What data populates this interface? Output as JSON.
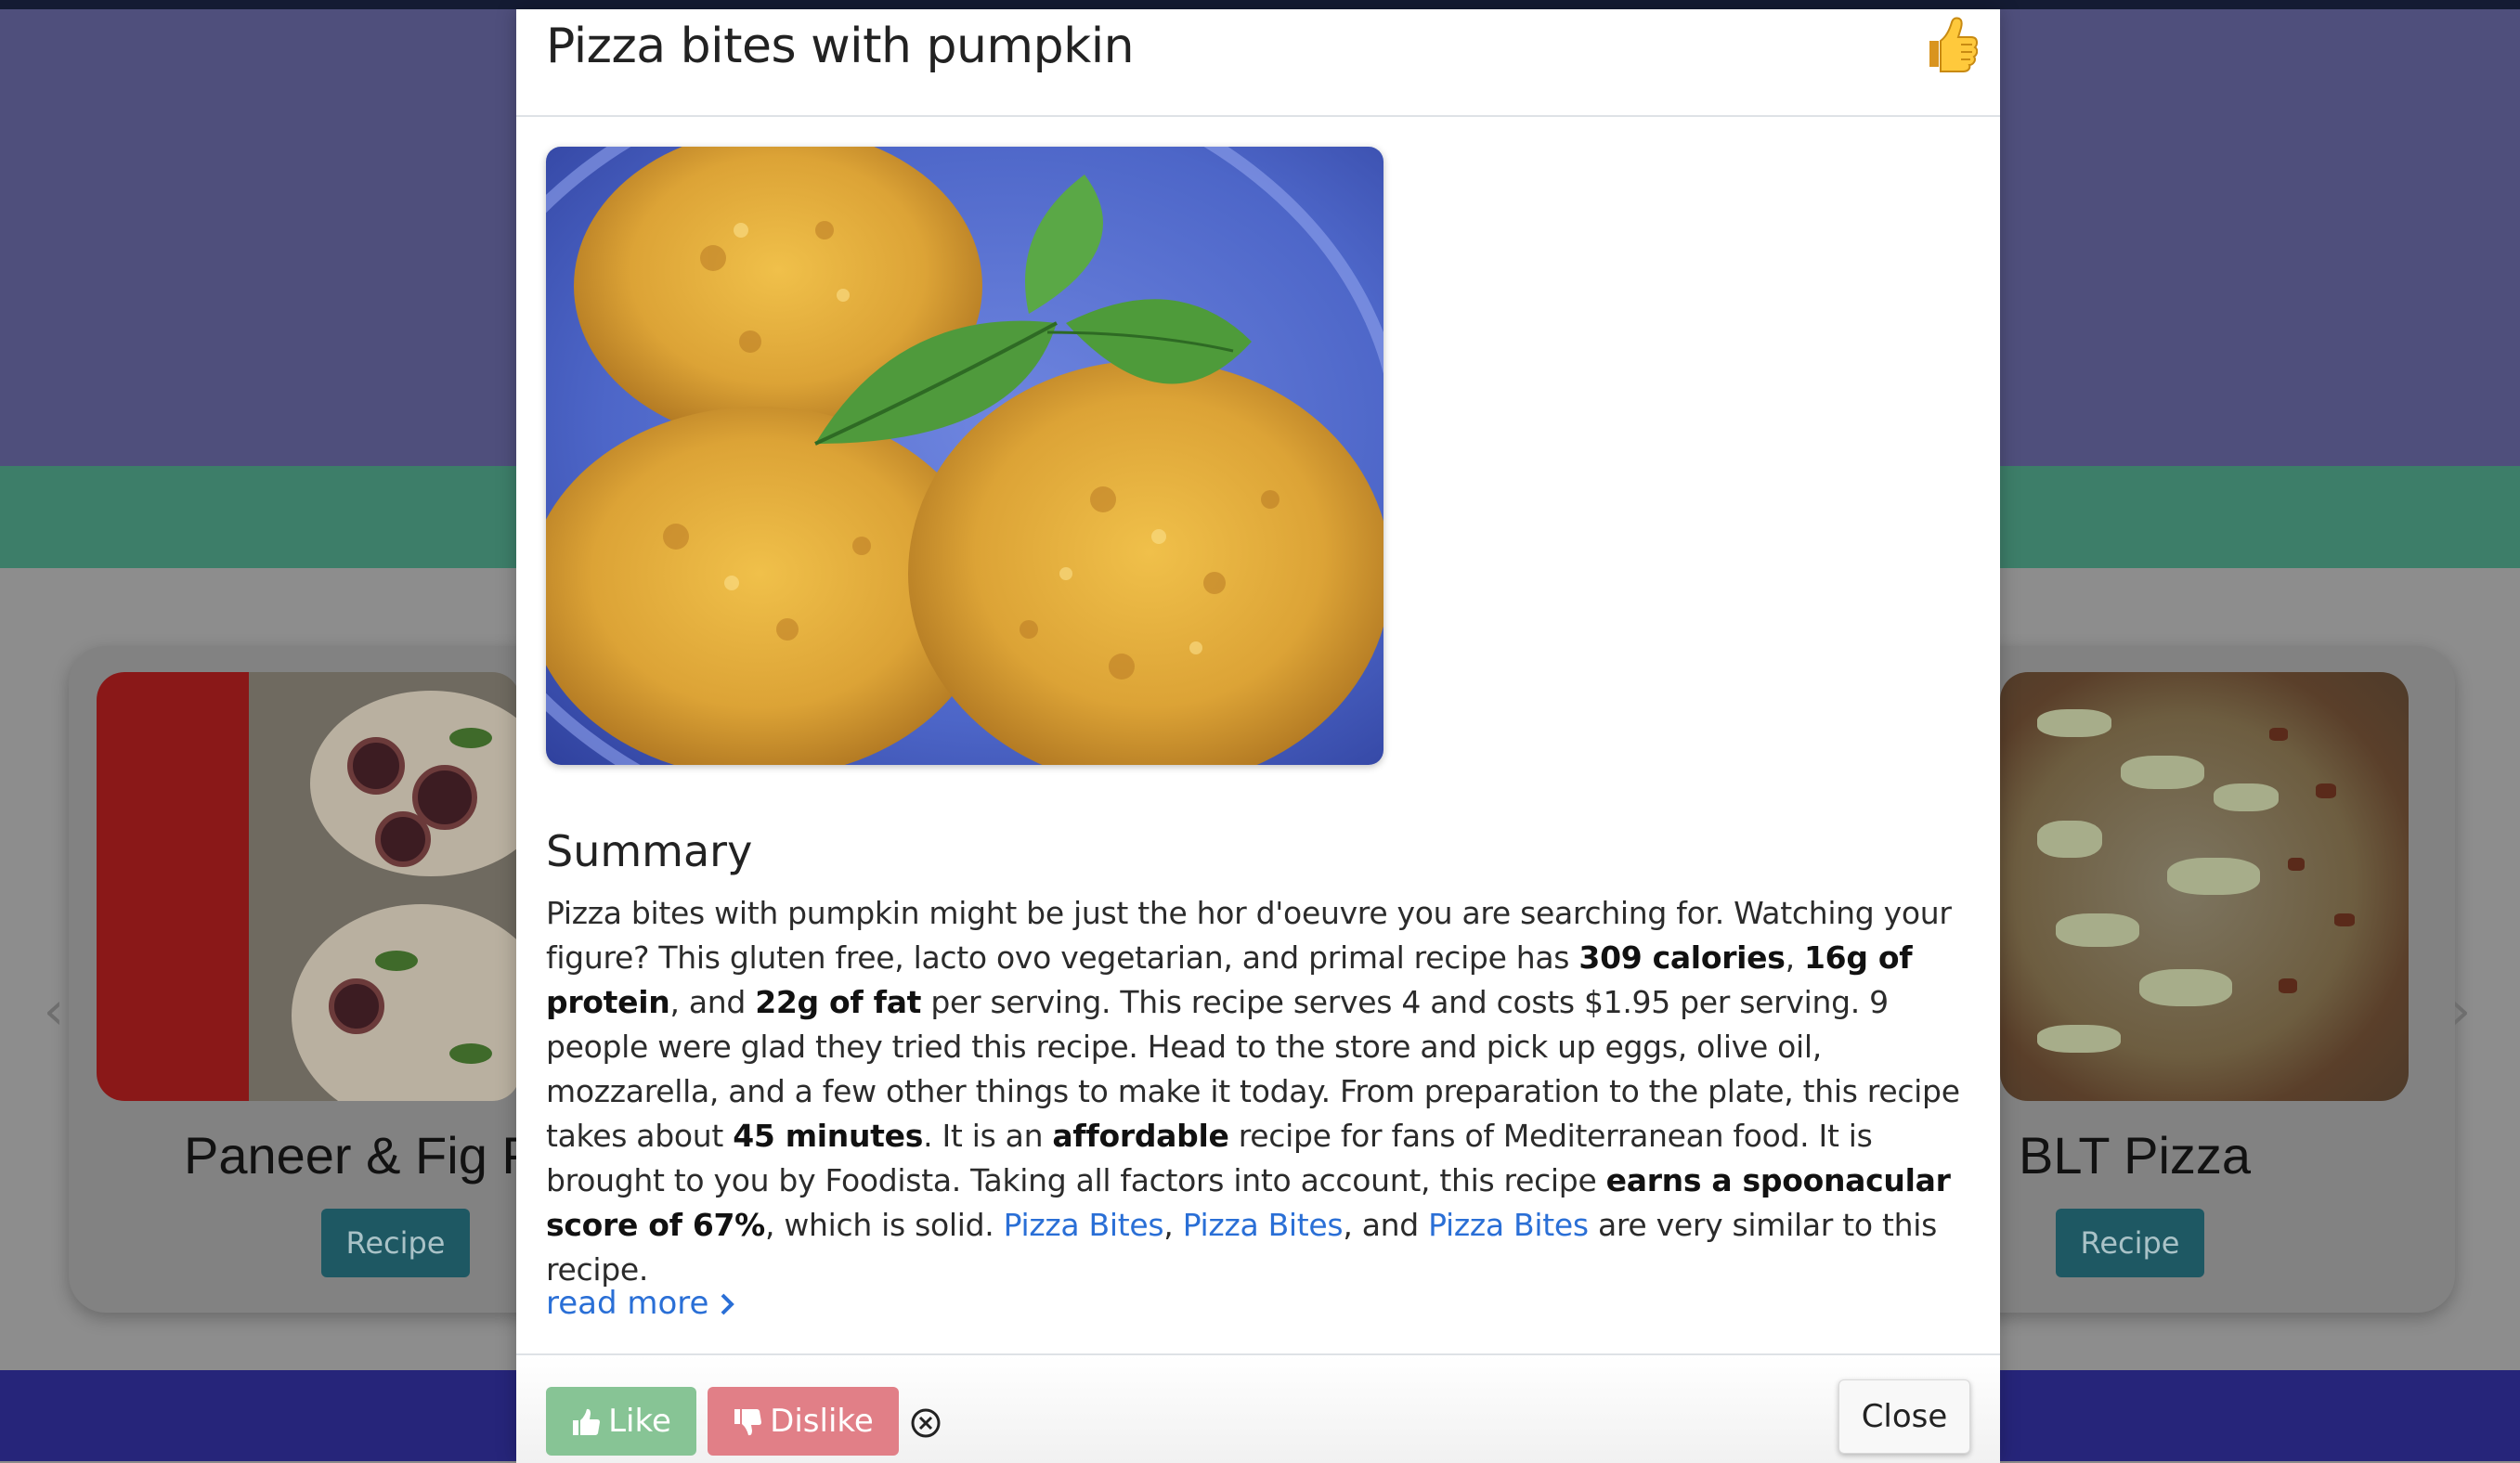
{
  "background": {
    "carousel_cards": [
      {
        "title": "Paneer & Fig P",
        "button_label": "Recipe"
      },
      {
        "title": "BLT Pizza",
        "button_label": "Recipe"
      }
    ],
    "arrows": {
      "prev": "‹",
      "next": "›"
    }
  },
  "modal": {
    "title": "Pizza bites with pumpkin",
    "header_icon": "thumbs-up-icon",
    "summary_heading": "Summary",
    "summary": {
      "s1": "Pizza bites with pumpkin might be just the hor d'oeuvre you are searching for. Watching your figure? This gluten free, lacto ovo vegetarian, and primal recipe has ",
      "calories": "309 calories",
      "s2": ", ",
      "protein": "16g of protein",
      "s3": ", and ",
      "fat": "22g of fat",
      "s4": " per serving. This recipe serves 4 and costs $1.95 per serving. 9 people were glad they tried this recipe. Head to the store and pick up eggs, olive oil, mozzarella, and a few other things to make it today. From preparation to the plate, this recipe takes about ",
      "time": "45 minutes",
      "s5": ". It is an ",
      "affordable": "affordable",
      "s6": " recipe for fans of Mediterranean food. It is brought to you by Foodista. Taking all factors into account, this recipe ",
      "score": "earns a spoonacular score of 67%",
      "s7": ", which is solid. ",
      "link1": "Pizza Bites",
      "s8": ", ",
      "link2": "Pizza Bites",
      "s9": ", and ",
      "link3": "Pizza Bites",
      "s10": " are very similar to this recipe."
    },
    "read_more": "read more",
    "footer": {
      "like_label": "Like",
      "dislike_label": "Dislike",
      "close_label": "Close"
    }
  },
  "colors": {
    "link": "#2a6fd6",
    "like": "#87c495",
    "dislike": "#e17f87",
    "recipe_button": "#1e5863"
  }
}
